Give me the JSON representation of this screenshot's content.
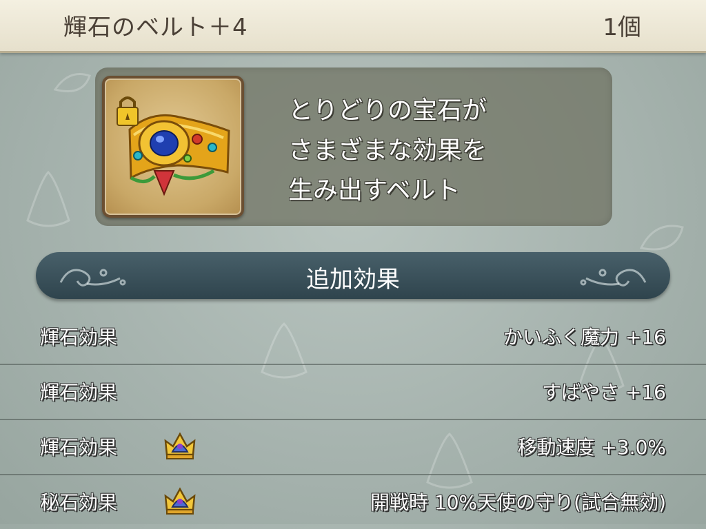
{
  "item": {
    "name": "輝石のベルト＋4",
    "count": "1個",
    "icon": "jeweled-belt-icon",
    "locked": true,
    "description": "とりどりの宝石が\nさまざまな効果を\n生み出すベルト"
  },
  "section": {
    "title": "追加効果"
  },
  "effects": [
    {
      "label": "輝石効果",
      "value": "かいふく魔力 +16",
      "crown": false
    },
    {
      "label": "輝石効果",
      "value": "すばやさ +16",
      "crown": false
    },
    {
      "label": "輝石効果",
      "value": "移動速度 +3.0%",
      "crown": true
    },
    {
      "label": "秘石効果",
      "value": "開戦時 10%天使の守り(試合無効)",
      "crown": true
    }
  ],
  "colors": {
    "background": "#a6b3ae",
    "title_bar": "#ede8d6",
    "banner": "#3b525b",
    "text_outline": "#2e2e2e"
  }
}
